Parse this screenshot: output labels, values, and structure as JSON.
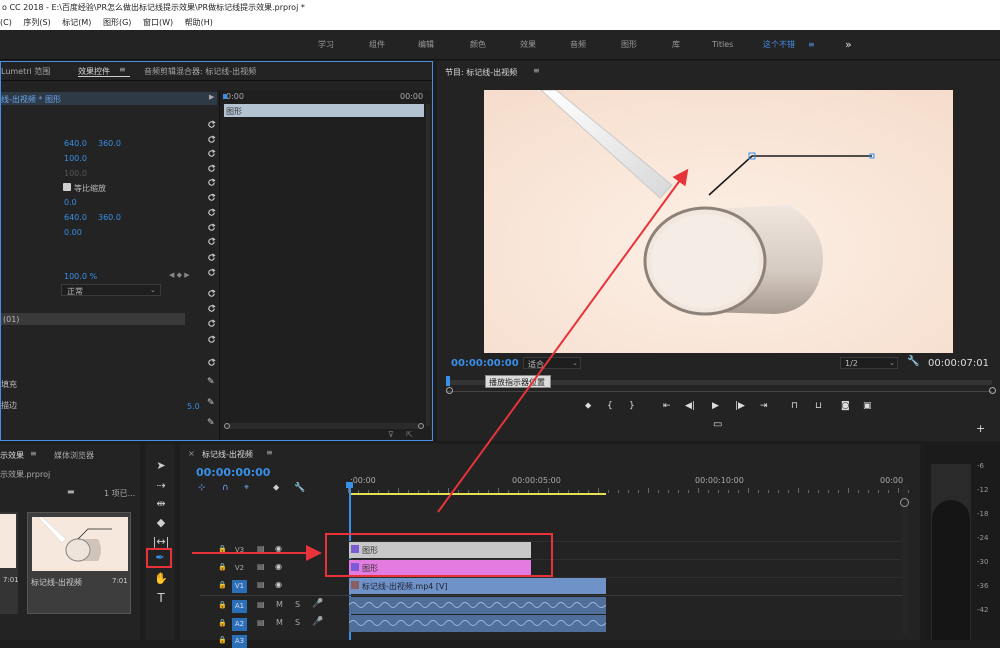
{
  "window": {
    "title": "o CC 2018 - E:\\百度经验\\PR怎么做出标记线提示效果\\PR做标记线提示效果.prproj *"
  },
  "menu": [
    "(C)",
    "序列(S)",
    "标记(M)",
    "图形(G)",
    "窗口(W)",
    "帮助(H)"
  ],
  "workspaces": {
    "items": [
      "学习",
      "组件",
      "编辑",
      "颜色",
      "效果",
      "音频",
      "图形",
      "库",
      "Titles",
      "这个不错"
    ],
    "active": "这个不错",
    "more": "»"
  },
  "effect_panel": {
    "tabs": [
      "Lumetri 范围",
      "效果控件",
      "音频剪辑混合器: 标记线-出视频"
    ],
    "active_tab": "效果控件",
    "clip_label": "线-出视频 * 图形",
    "mini_timeline": {
      "start": "0:00",
      "end": "00:00",
      "bar_label": "图形"
    },
    "values": {
      "position_x": "640.0",
      "position_y": "360.0",
      "scale": "100.0",
      "scale_width": "100.0",
      "uniform_scale": "等比缩放",
      "rotation": "0.0",
      "anchor_x": "640.0",
      "anchor_y": "360.0",
      "flicker": "0.00",
      "opacity": "100.0 %",
      "blend_mode": "正常",
      "shape_label": "(01)",
      "fill_label": "填充",
      "stroke_label": "描边",
      "stroke_value": "5.0"
    }
  },
  "program": {
    "title": "节目: 标记线-出视频",
    "timecode": "00:00:00:00",
    "fit": "适合",
    "resolution": "1/2",
    "duration": "00:00:07:01",
    "tooltip": "播放指示器位置"
  },
  "project": {
    "tabs": [
      "示效果",
      "媒体浏览器"
    ],
    "file": "示效果.prproj",
    "count": "1 项已...",
    "thumb1_duration": "7:01",
    "thumb2_label": "标记线-出视频",
    "thumb2_duration": "7:01"
  },
  "timeline": {
    "title": "标记线-出视频",
    "timecode": "00:00:00:00",
    "ruler": [
      ":00:00",
      "00:00:05:00",
      "00:00:10:00",
      "00:00"
    ],
    "tracks": {
      "v3": "V3",
      "v2": "V2",
      "v1": "V1",
      "a1": "A1",
      "a2": "A2",
      "a3": "A3"
    },
    "clips": {
      "v3": "图形",
      "v2": "图形",
      "v1": "标记线-出视频.mp4 [V]"
    }
  },
  "audio_meter": {
    "ticks": [
      "-6",
      "-12",
      "-18",
      "-24",
      "-30",
      "-36",
      "-42"
    ]
  },
  "colors": {
    "accent": "#3a8fe8",
    "annotation": "#e8333a",
    "clip_v3": "#c8c8c8",
    "clip_v2": "#e47be0",
    "clip_v1": "#6f93c9"
  }
}
